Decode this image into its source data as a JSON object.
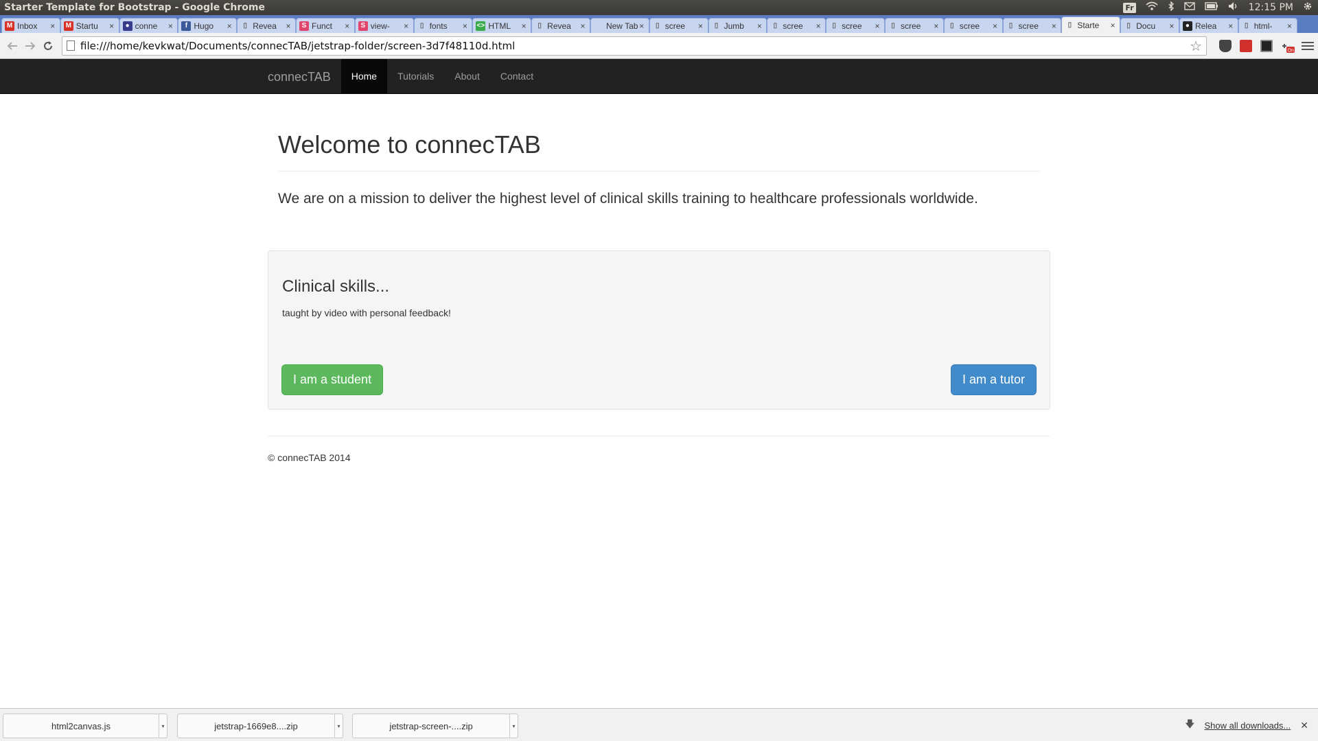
{
  "os": {
    "window_title": "Starter Template for Bootstrap - Google Chrome",
    "keyboard": "Fr",
    "clock": "12:15 PM"
  },
  "tabs": [
    {
      "title": "Inbox",
      "icon": "gmail-icon",
      "color": "#d93025",
      "glyph": "M"
    },
    {
      "title": "Startu",
      "icon": "gmail-icon",
      "color": "#d93025",
      "glyph": "M"
    },
    {
      "title": "conne",
      "icon": "circle-icon",
      "color": "#3a3a8c",
      "glyph": "●"
    },
    {
      "title": "Hugo",
      "icon": "facebook-icon",
      "color": "#3b5998",
      "glyph": "f"
    },
    {
      "title": "Revea",
      "icon": "page-icon",
      "color": "#888888",
      "glyph": "▯"
    },
    {
      "title": "Funct",
      "icon": "s-icon",
      "color": "#e0456b",
      "glyph": "S"
    },
    {
      "title": "view-",
      "icon": "s-icon",
      "color": "#e0456b",
      "glyph": "S"
    },
    {
      "title": "fonts",
      "icon": "page-icon",
      "color": "#888888",
      "glyph": "▯"
    },
    {
      "title": "HTML",
      "icon": "html-icon",
      "color": "#3aa94a",
      "glyph": "<>"
    },
    {
      "title": "Revea",
      "icon": "page-icon",
      "color": "#888888",
      "glyph": "▯"
    },
    {
      "title": "New Tab",
      "icon": "none",
      "color": "#c8d5ef",
      "glyph": ""
    },
    {
      "title": "scree",
      "icon": "page-icon",
      "color": "#888888",
      "glyph": "▯"
    },
    {
      "title": "Jumb",
      "icon": "page-icon",
      "color": "#888888",
      "glyph": "▯"
    },
    {
      "title": "scree",
      "icon": "page-icon",
      "color": "#888888",
      "glyph": "▯"
    },
    {
      "title": "scree",
      "icon": "page-icon",
      "color": "#888888",
      "glyph": "▯"
    },
    {
      "title": "scree",
      "icon": "page-icon",
      "color": "#888888",
      "glyph": "▯"
    },
    {
      "title": "scree",
      "icon": "page-icon",
      "color": "#888888",
      "glyph": "▯"
    },
    {
      "title": "scree",
      "icon": "page-icon",
      "color": "#888888",
      "glyph": "▯"
    },
    {
      "title": "Starte",
      "icon": "page-icon",
      "color": "#888888",
      "glyph": "▯",
      "active": true
    },
    {
      "title": "Docu",
      "icon": "page-icon",
      "color": "#888888",
      "glyph": "▯"
    },
    {
      "title": "Relea",
      "icon": "github-icon",
      "color": "#222222",
      "glyph": "●"
    },
    {
      "title": "html-",
      "icon": "page-icon",
      "color": "#888888",
      "glyph": "▯"
    }
  ],
  "toolbar": {
    "url": "file:///home/kevkwat/Documents/connecTAB/jetstrap-folder/screen-3d7f48110d.html"
  },
  "navbar": {
    "brand": "connecTAB",
    "items": [
      "Home",
      "Tutorials",
      "About",
      "Contact"
    ],
    "active_index": 0
  },
  "header": {
    "title": "Welcome to connecTAB",
    "lead": "We are on a mission to deliver the highest level of clinical skills training to healthcare professionals worldwide."
  },
  "jumbotron": {
    "title": "Clinical skills...",
    "subtitle": "taught by video with personal feedback!",
    "student_button": "I am a student",
    "tutor_button": "I am a tutor"
  },
  "footer": {
    "text": "© connecTAB 2014"
  },
  "downloads": {
    "items": [
      "html2canvas.js",
      "jetstrap-1669e8....zip",
      "jetstrap-screen-....zip"
    ],
    "show_all": "Show all downloads..."
  },
  "colors": {
    "navbar_bg": "#222222",
    "success": "#5cb85c",
    "primary": "#428bca",
    "tab_strip": "#5a7cc2"
  }
}
